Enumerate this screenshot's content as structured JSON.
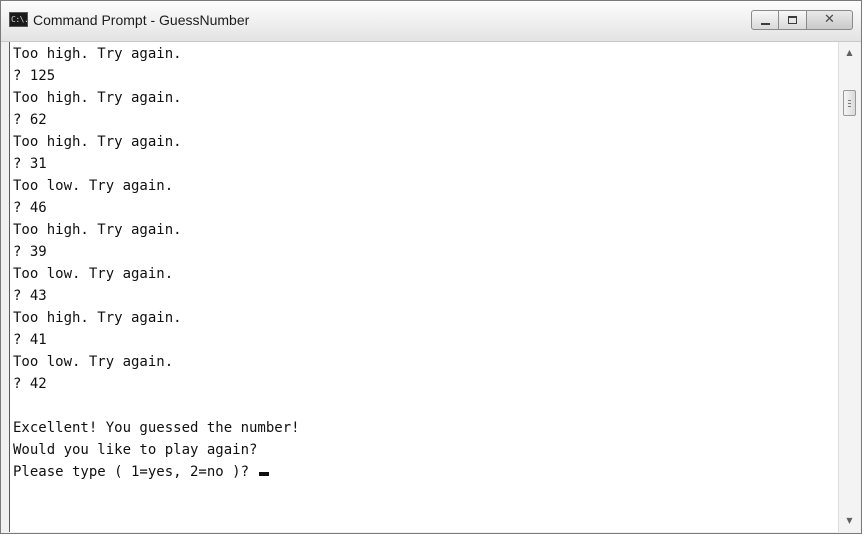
{
  "window": {
    "title": "Command Prompt - GuessNumber",
    "icon_text": "C:\\."
  },
  "console": {
    "lines": [
      "Too high. Try again.",
      "? 125",
      "Too high. Try again.",
      "? 62",
      "Too high. Try again.",
      "? 31",
      "Too low. Try again.",
      "? 46",
      "Too high. Try again.",
      "? 39",
      "Too low. Try again.",
      "? 43",
      "Too high. Try again.",
      "? 41",
      "Too low. Try again.",
      "? 42",
      "",
      "Excellent! You guessed the number!",
      "Would you like to play again?",
      "Please type ( 1=yes, 2=no )? "
    ]
  },
  "icons": {
    "app": "command-prompt-icon",
    "minimize": "minimize-icon",
    "maximize": "maximize-icon",
    "close": "close-icon",
    "scroll_up": "scroll-up-arrow-icon",
    "scroll_down": "scroll-down-arrow-icon"
  }
}
